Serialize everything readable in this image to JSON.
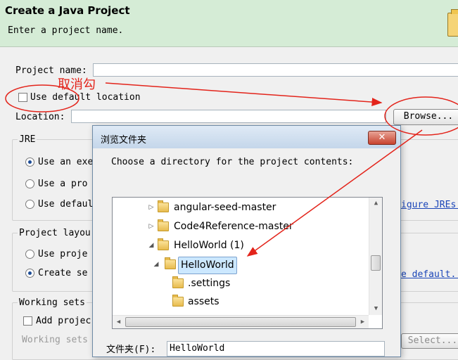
{
  "header": {
    "title": "Create a Java Project",
    "subtitle": "Enter a project name."
  },
  "form": {
    "project_name_label": "Project name:",
    "project_name_value": "",
    "use_default_location_label": "Use default location",
    "use_default_location_checked": false,
    "location_label": "Location:",
    "location_value": "",
    "browse_button": "Browse..."
  },
  "jre": {
    "title": "JRE",
    "options": [
      "Use an exe",
      "Use a pro",
      "Use defaul"
    ],
    "selected_index": 0,
    "link": "igure JREs..."
  },
  "project_layout": {
    "title": "Project layou",
    "options": [
      "Use proje",
      "Create se"
    ],
    "selected_index": 1,
    "link": "e default..."
  },
  "working_sets": {
    "title": "Working sets",
    "add_label": "Add projec",
    "sets_label": "Working sets",
    "select_button": "Select..."
  },
  "dialog": {
    "title": "浏览文件夹",
    "close_label": "✕",
    "prompt": "Choose a directory for the project contents:",
    "tree": [
      {
        "label": "angular-seed-master",
        "expanded": false,
        "selected": false
      },
      {
        "label": "Code4Reference-master",
        "expanded": false,
        "selected": false
      },
      {
        "label": "HelloWorld (1)",
        "expanded": true,
        "selected": false
      },
      {
        "label": "HelloWorld",
        "expanded": true,
        "selected": true
      },
      {
        "label": ".settings",
        "expanded": false,
        "selected": false
      },
      {
        "label": "assets",
        "expanded": false,
        "selected": false
      }
    ],
    "folder_label": "文件夹(F):",
    "folder_value": "HelloWorld"
  },
  "annotation": {
    "text": "取消勾",
    "color": "#e3241b"
  }
}
